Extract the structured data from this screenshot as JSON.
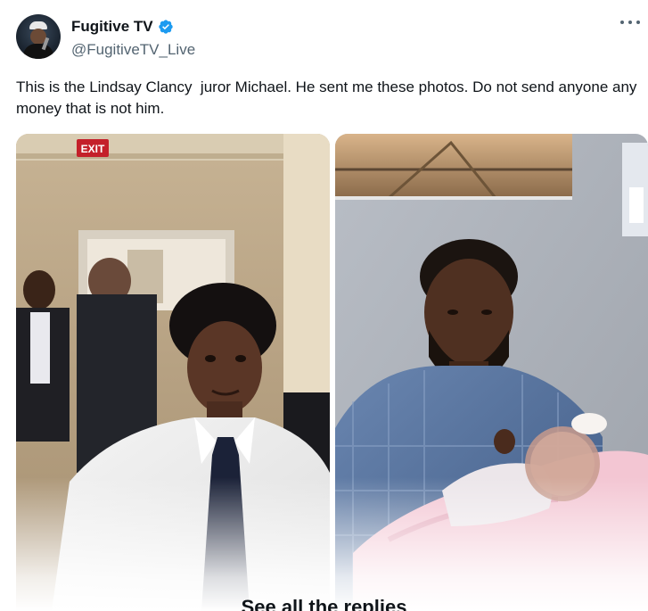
{
  "tweet": {
    "display_name": "Fugitive TV",
    "handle": "@FugitiveTV_Live",
    "verified": true,
    "text": "This is the Lindsay Clancy  juror Michael. He sent me these photos. Do not send anyone any money that is not him."
  },
  "media": {
    "photo_left": {
      "sign": "EXIT",
      "icon": "photo-man-white-shirt"
    },
    "photo_right": {
      "icon": "photo-man-holding-baby"
    }
  },
  "footer": {
    "see_replies_label": "See all the replies"
  },
  "colors": {
    "accent": "#1d9bf0",
    "text": "#0f1419",
    "muted": "#536471"
  }
}
